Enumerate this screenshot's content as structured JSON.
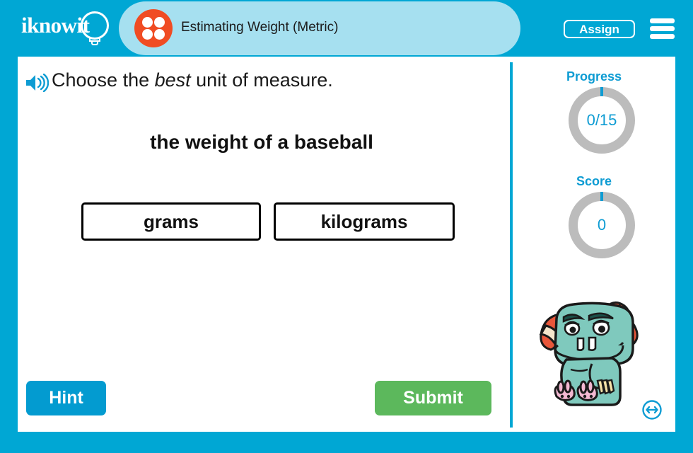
{
  "app": {
    "logo_text": "iknowit",
    "logo_icon": "lightbulb-icon"
  },
  "header": {
    "activity_icon": "dice-four-icon",
    "title": "Estimating Weight (Metric)",
    "assign_label": "Assign",
    "menu_icon": "hamburger-menu-icon",
    "background_color": "#00a7d4",
    "pill_color": "#a6e0f0",
    "dice_color": "#f04c23"
  },
  "question": {
    "speaker_icon": "speaker-audio-icon",
    "instruction_before": "Choose the ",
    "instruction_emphasis": "best",
    "instruction_after": " unit of measure.",
    "prompt": "the weight of a baseball"
  },
  "choices": [
    {
      "label": "grams"
    },
    {
      "label": "kilograms"
    }
  ],
  "actions": {
    "hint_label": "Hint",
    "hint_color": "#039bd0",
    "submit_label": "Submit",
    "submit_color": "#5cb85c"
  },
  "sidebar": {
    "progress_label": "Progress",
    "progress_value": "0/15",
    "score_label": "Score",
    "score_value": "0",
    "ring_color": "#bcbcbc",
    "accent_color": "#0e9cd3",
    "mascot_icon": "troll-mascot-character",
    "resize_icon": "resize-fullscreen-icon"
  }
}
